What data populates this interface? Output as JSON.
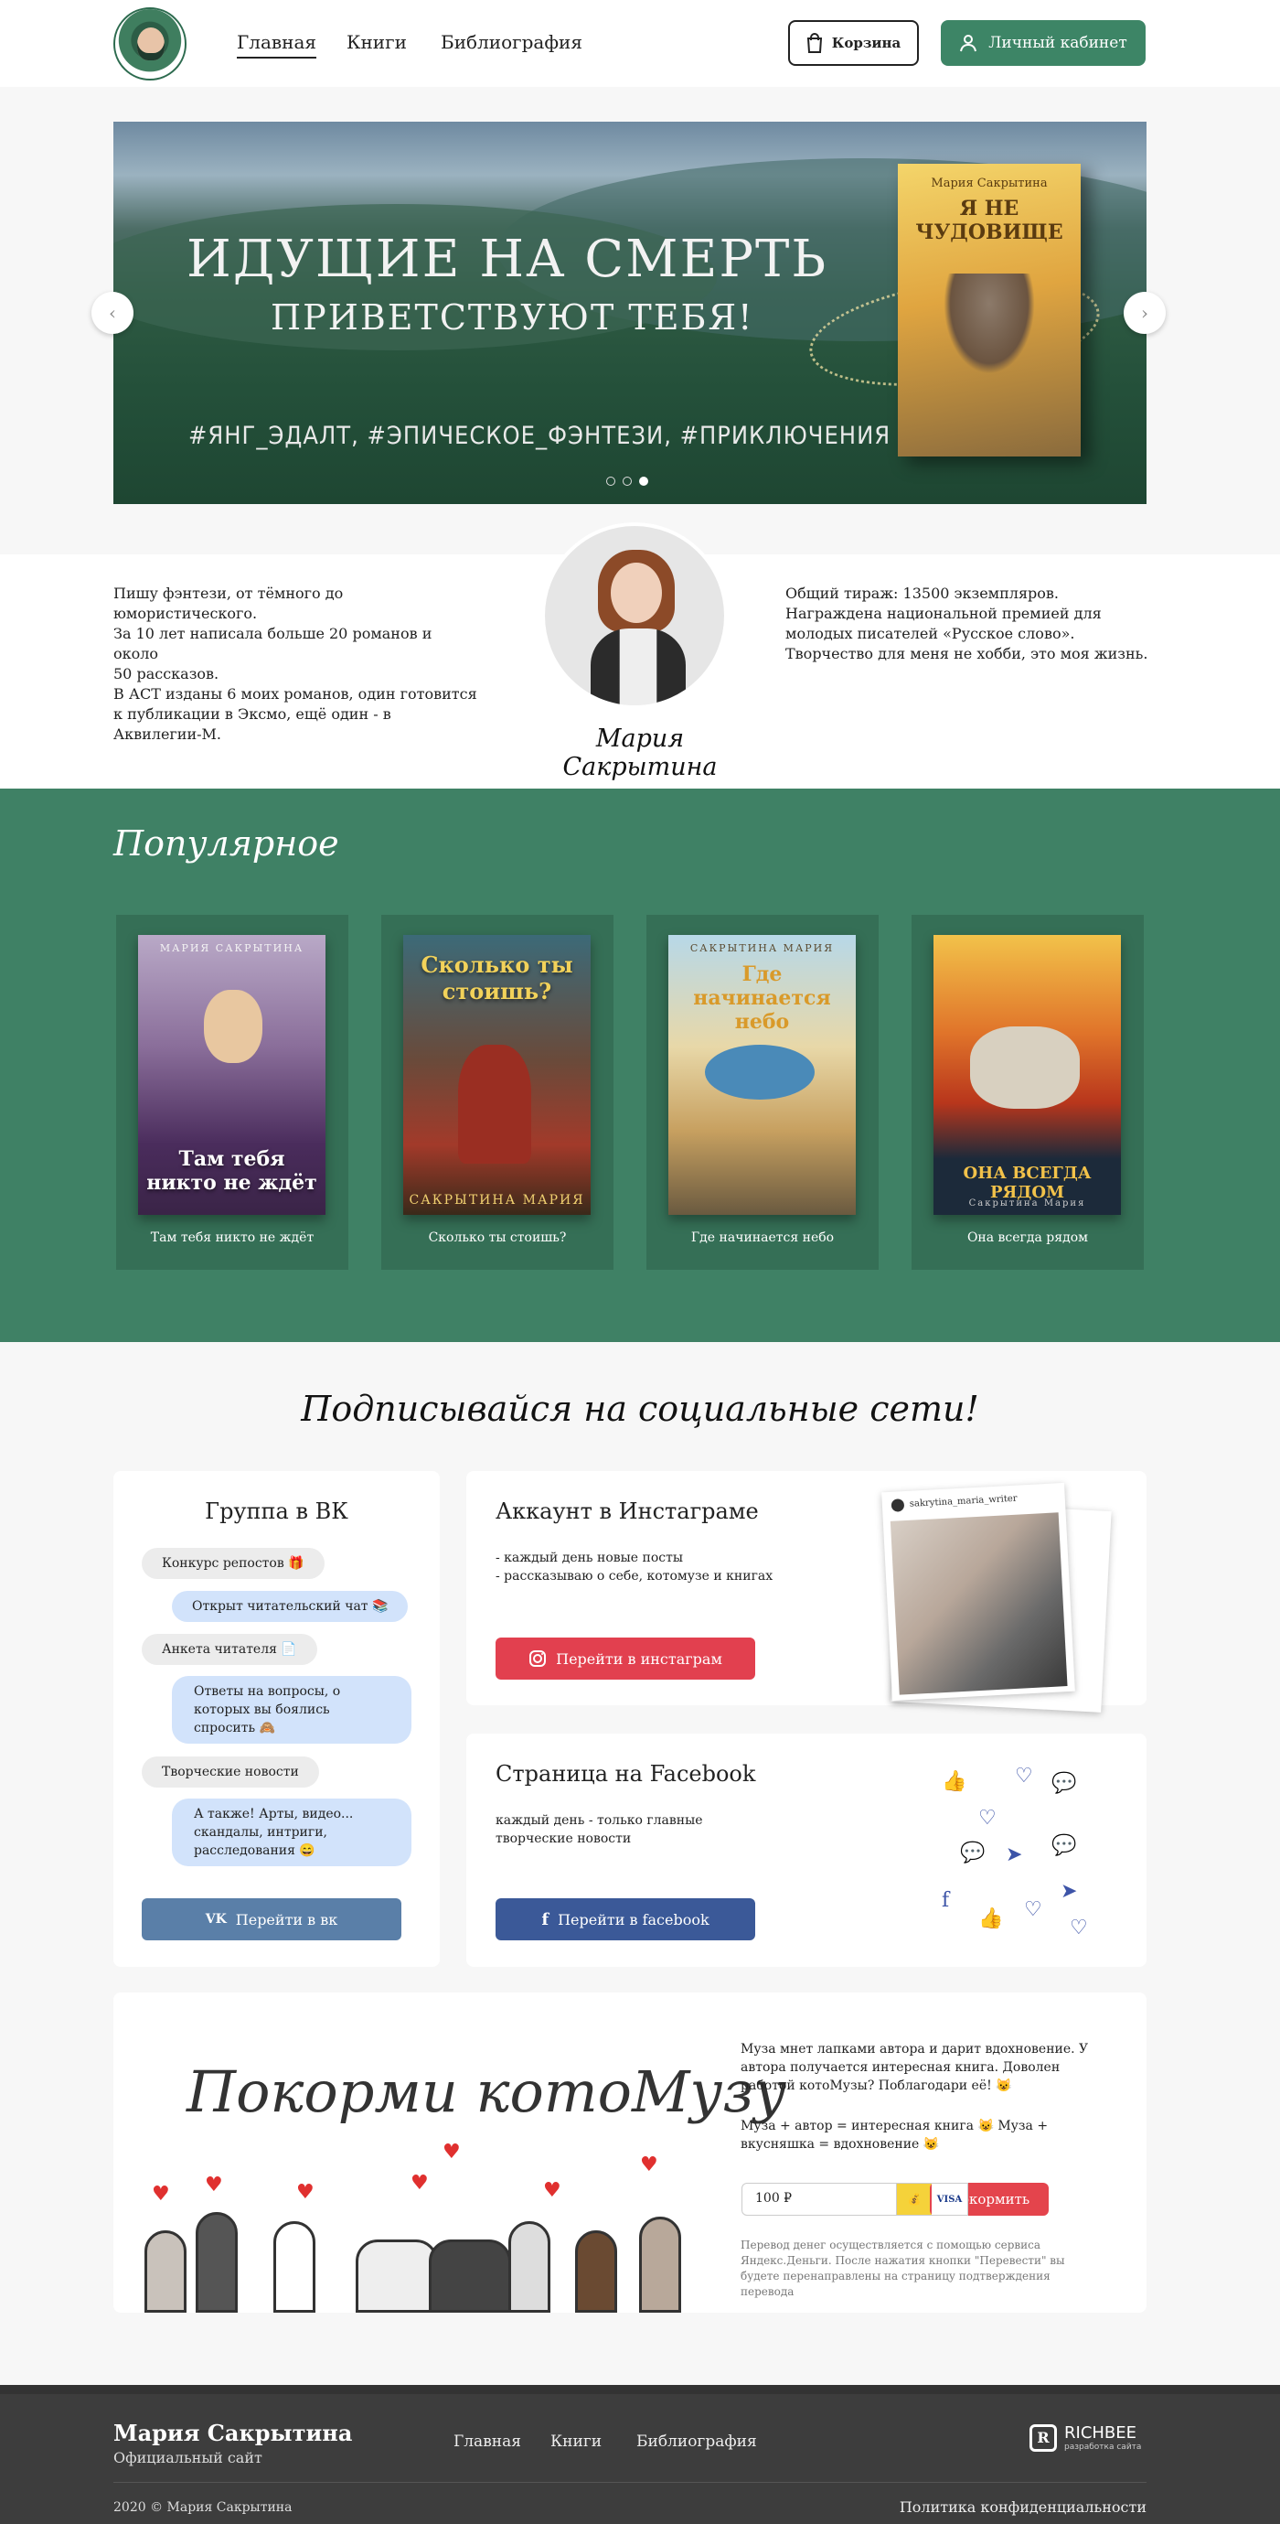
{
  "header": {
    "nav": [
      "Главная",
      "Книги",
      "Библиография"
    ],
    "cart": "Корзина",
    "cabinet": "Личный кабинет"
  },
  "hero": {
    "title1": "ИДУЩИЕ НА СМЕРТЬ",
    "title2": "ПРИВЕТСТВУЮТ ТЕБЯ!",
    "tags": "#ЯНГ_ЭДАЛТ, #ЭПИЧЕСКОЕ_ФЭНТЕЗИ, #ПРИКЛЮЧЕНИЯ",
    "book_author": "Мария Сакрытина",
    "book_title": "Я НЕ ЧУДОВИЩЕ",
    "slides_total": 3,
    "slide_active": 3
  },
  "about": {
    "left": "Пишу фэнтези, от тёмного до\nюмористического.\nЗа 10 лет написала больше 20 романов и около\n50 рассказов.\nВ АСТ изданы 6 моих романов, один готовится\nк публикации в Эксмо, ещё один - в\nАквилегии-М.",
    "right": "Общий тираж: 13500 экземпляров.\nНаграждена национальной премией для\nмолодых писателей «Русское слово».\nТворчество для меня не хобби, это моя жизнь.",
    "signature": "Мария Сакрытина"
  },
  "popular": {
    "title": "Популярное",
    "books": [
      {
        "title": "Там тебя никто не ждёт",
        "cover_author": "МАРИЯ САКРЫТИНА",
        "cover_title": "Там тебя никто не ждёт"
      },
      {
        "title": "Сколько ты стоишь?",
        "cover_author": "САКРЫТИНА МАРИЯ",
        "cover_title": "Сколько ты стоишь?"
      },
      {
        "title": "Где начинается небо",
        "cover_author": "САКРЫТИНА МАРИЯ",
        "cover_title": "Где начинается небо"
      },
      {
        "title": "Она всегда рядом",
        "cover_author": "Сакрытина Мария",
        "cover_title": "ОНА ВСЕГДА РЯДОМ"
      }
    ]
  },
  "social": {
    "title": "Подписывайся на социальные сети!",
    "vk": {
      "title": "Группа в ВК",
      "items": [
        "Конкурс репостов 🎁",
        "Открыт читательский чат 📚",
        "Анкета читателя 📄",
        "Ответы на вопросы, о которых вы боялись спросить 🙈",
        "Творческие новости",
        "А также! Арты, видео... скандалы, интриги, расследования 😄"
      ],
      "button": "Перейти в вк"
    },
    "instagram": {
      "title": "Аккаунт в Инстаграме",
      "text": "- каждый день новые посты\n- рассказываю о себе, котомузе и книгах",
      "button": "Перейти в инстаграм",
      "handle": "sakrytina_maria_writer"
    },
    "facebook": {
      "title": "Страница на Facebook",
      "text": "каждый день - только главные\nтворческие новости",
      "button": "Перейти в facebook"
    }
  },
  "kotomuza": {
    "title": "Покорми котоМузу",
    "text1": "Муза мнет лапками автора и дарит вдохновение. У автора получается интересная книга. Доволен работой котоМузы? Поблагодари её! 😺",
    "text2": "Муза + автор = интересная книга 😺  Муза + вкусняшка = вдохновение 😺",
    "amount": "100 ₽",
    "button": "Покормить",
    "note": "Перевод денег осуществляется с помощью сервиса Яндекс.Деньги. После нажатия кнопки \"Перевести\" вы будете перенаправлены на страницу подтверждения перевода"
  },
  "footer": {
    "name": "Мария Сакрытина",
    "subtitle": "Официальный сайт",
    "nav": [
      "Главная",
      "Книги",
      "Библиография"
    ],
    "copyright": "2020 © Мария Сакрытина",
    "policy": "Политика конфиденциальности",
    "dev_brand": "RICHBEE",
    "dev_sub": "разработка сайта"
  }
}
